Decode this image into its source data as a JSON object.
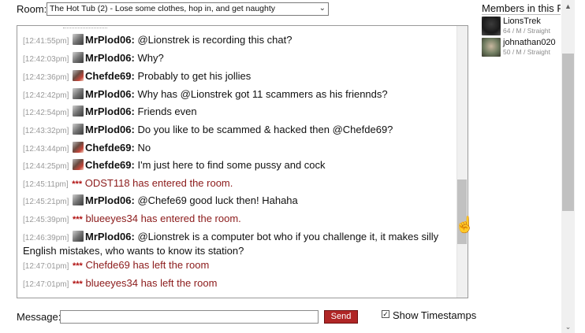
{
  "room": {
    "label": "Room:",
    "selected": "The Hot Tub (2) - Lose some clothes, hop in, and get naughty"
  },
  "chat": {
    "messages": [
      {
        "time": "[12:41:55pm]",
        "kind": "user",
        "avatar": "mrplod",
        "user": "MrPlod06:",
        "text": "@Lionstrek is recording this chat?"
      },
      {
        "time": "[12:42:03pm]",
        "kind": "user",
        "avatar": "mrplod",
        "user": "MrPlod06:",
        "text": "Why?"
      },
      {
        "time": "[12:42:36pm]",
        "kind": "user",
        "avatar": "chefde",
        "user": "Chefde69:",
        "text": "Probably to get his jollies"
      },
      {
        "time": "[12:42:42pm]",
        "kind": "user",
        "avatar": "mrplod",
        "user": "MrPlod06:",
        "text": "Why has @Lionstrek got 11 scammers as his friennds?"
      },
      {
        "time": "[12:42:54pm]",
        "kind": "user",
        "avatar": "mrplod",
        "user": "MrPlod06:",
        "text": "Friends even"
      },
      {
        "time": "[12:43:32pm]",
        "kind": "user",
        "avatar": "mrplod",
        "user": "MrPlod06:",
        "text": "Do you like to be scammed & hacked then @Chefde69?"
      },
      {
        "time": "[12:43:44pm]",
        "kind": "user",
        "avatar": "chefde",
        "user": "Chefde69:",
        "text": "No"
      },
      {
        "time": "[12:44:25pm]",
        "kind": "user",
        "avatar": "chefde",
        "user": "Chefde69:",
        "text": "I'm just here to find some pussy and cock"
      },
      {
        "time": "[12:45:11pm]",
        "kind": "system",
        "stars": "***",
        "text": "ODST118 has entered the room."
      },
      {
        "time": "[12:45:21pm]",
        "kind": "user",
        "avatar": "mrplod",
        "user": "MrPlod06:",
        "text": "@Chefe69 good luck then! Hahaha"
      },
      {
        "time": "[12:45:39pm]",
        "kind": "system",
        "stars": "***",
        "text": "blueeyes34 has entered the room."
      },
      {
        "time": "[12:46:39pm]",
        "kind": "user",
        "avatar": "mrplod",
        "user": "MrPlod06:",
        "text": "@Lionstrek is a computer bot who if you challenge it, it makes silly English mistakes, who wants to know its station?"
      },
      {
        "time": "[12:47:01pm]",
        "kind": "system",
        "stars": "***",
        "text": "Chefde69 has left the room"
      },
      {
        "time": "[12:47:01pm]",
        "kind": "system",
        "stars": "***",
        "text": "blueeyes34 has left the room"
      }
    ]
  },
  "composer": {
    "label": "Message:",
    "value": "",
    "send_label": "Send",
    "show_timestamps_label": "Show Timestamps",
    "show_timestamps_checked": true
  },
  "members": {
    "title": "Members in this Ro",
    "list": [
      {
        "name": "LionsTrek",
        "info": "64 / M / Straight"
      },
      {
        "name": "johnathan020",
        "info": "50 / M / Straight"
      }
    ]
  },
  "colors": {
    "system_text": "#8b1a1a",
    "send_button": "#b02626",
    "timestamp": "#9a9a9a"
  },
  "icons": {
    "select_arrow": "chevron-down-icon",
    "cursor": "hand-pointer-icon",
    "checkbox": "checkbox-checked-icon"
  }
}
